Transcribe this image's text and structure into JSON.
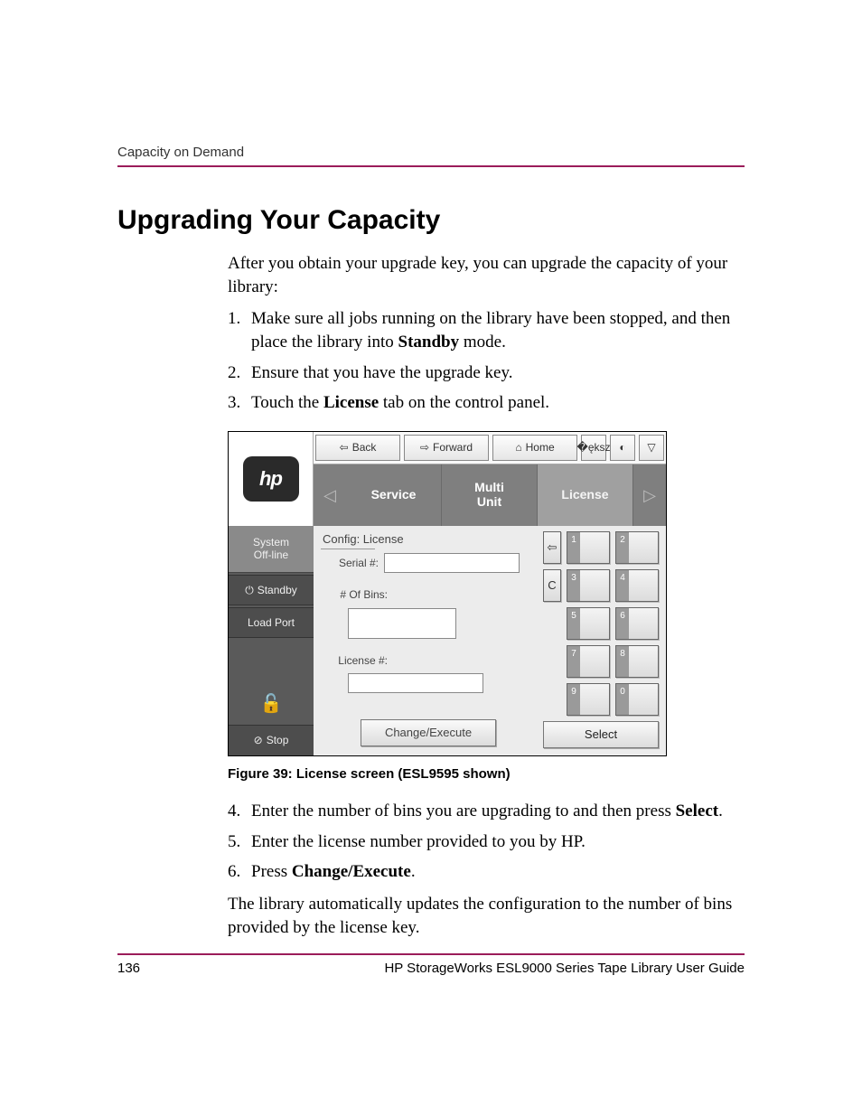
{
  "header": {
    "running_head": "Capacity on Demand"
  },
  "title": "Upgrading Your Capacity",
  "intro": "After you obtain your upgrade key, you can upgrade the capacity of your library:",
  "steps_a": [
    {
      "n": "1.",
      "pre": "Make sure all jobs running on the library have been stopped, and then place the library into ",
      "bold": "Standby",
      "post": " mode."
    },
    {
      "n": "2.",
      "pre": "Ensure that you have the upgrade key.",
      "bold": "",
      "post": ""
    },
    {
      "n": "3.",
      "pre": "Touch the ",
      "bold": "License",
      "post": " tab on the control panel."
    }
  ],
  "figure": {
    "caption": "Figure 39:  License screen (ESL9595 shown)",
    "logo_text": "hp",
    "toolbar": {
      "back": "Back",
      "forward": "Forward",
      "home": "Home"
    },
    "tabs": {
      "service": "Service",
      "multi_unit": "Multi\nUnit",
      "license": "License"
    },
    "sidebar": {
      "status_line1": "System",
      "status_line2": "Off-line",
      "standby": "Standby",
      "load_port": "Load Port",
      "stop": "Stop"
    },
    "form": {
      "config_title": "Config: License",
      "serial_label": "Serial #:",
      "bins_label": "# Of Bins:",
      "license_label": "License #:",
      "change_execute": "Change/Execute"
    },
    "keypad": {
      "back_icon": "⇦",
      "clear": "C",
      "k1": "1",
      "k2": "2",
      "k3": "3",
      "k4": "4",
      "k5": "5",
      "k6": "6",
      "k7": "7",
      "k8": "8",
      "k9": "9",
      "k0": "0",
      "select": "Select"
    }
  },
  "steps_b": [
    {
      "n": "4.",
      "pre": "Enter the number of bins you are upgrading to and then press ",
      "bold": "Select",
      "post": "."
    },
    {
      "n": "5.",
      "pre": "Enter the license number provided to you by HP.",
      "bold": "",
      "post": ""
    },
    {
      "n": "6.",
      "pre": "Press ",
      "bold": "Change/Execute",
      "post": "."
    }
  ],
  "closing": "The library automatically updates the configuration to the number of bins provided by the license key.",
  "footer": {
    "page": "136",
    "doc": "HP StorageWorks ESL9000 Series Tape Library User Guide"
  }
}
